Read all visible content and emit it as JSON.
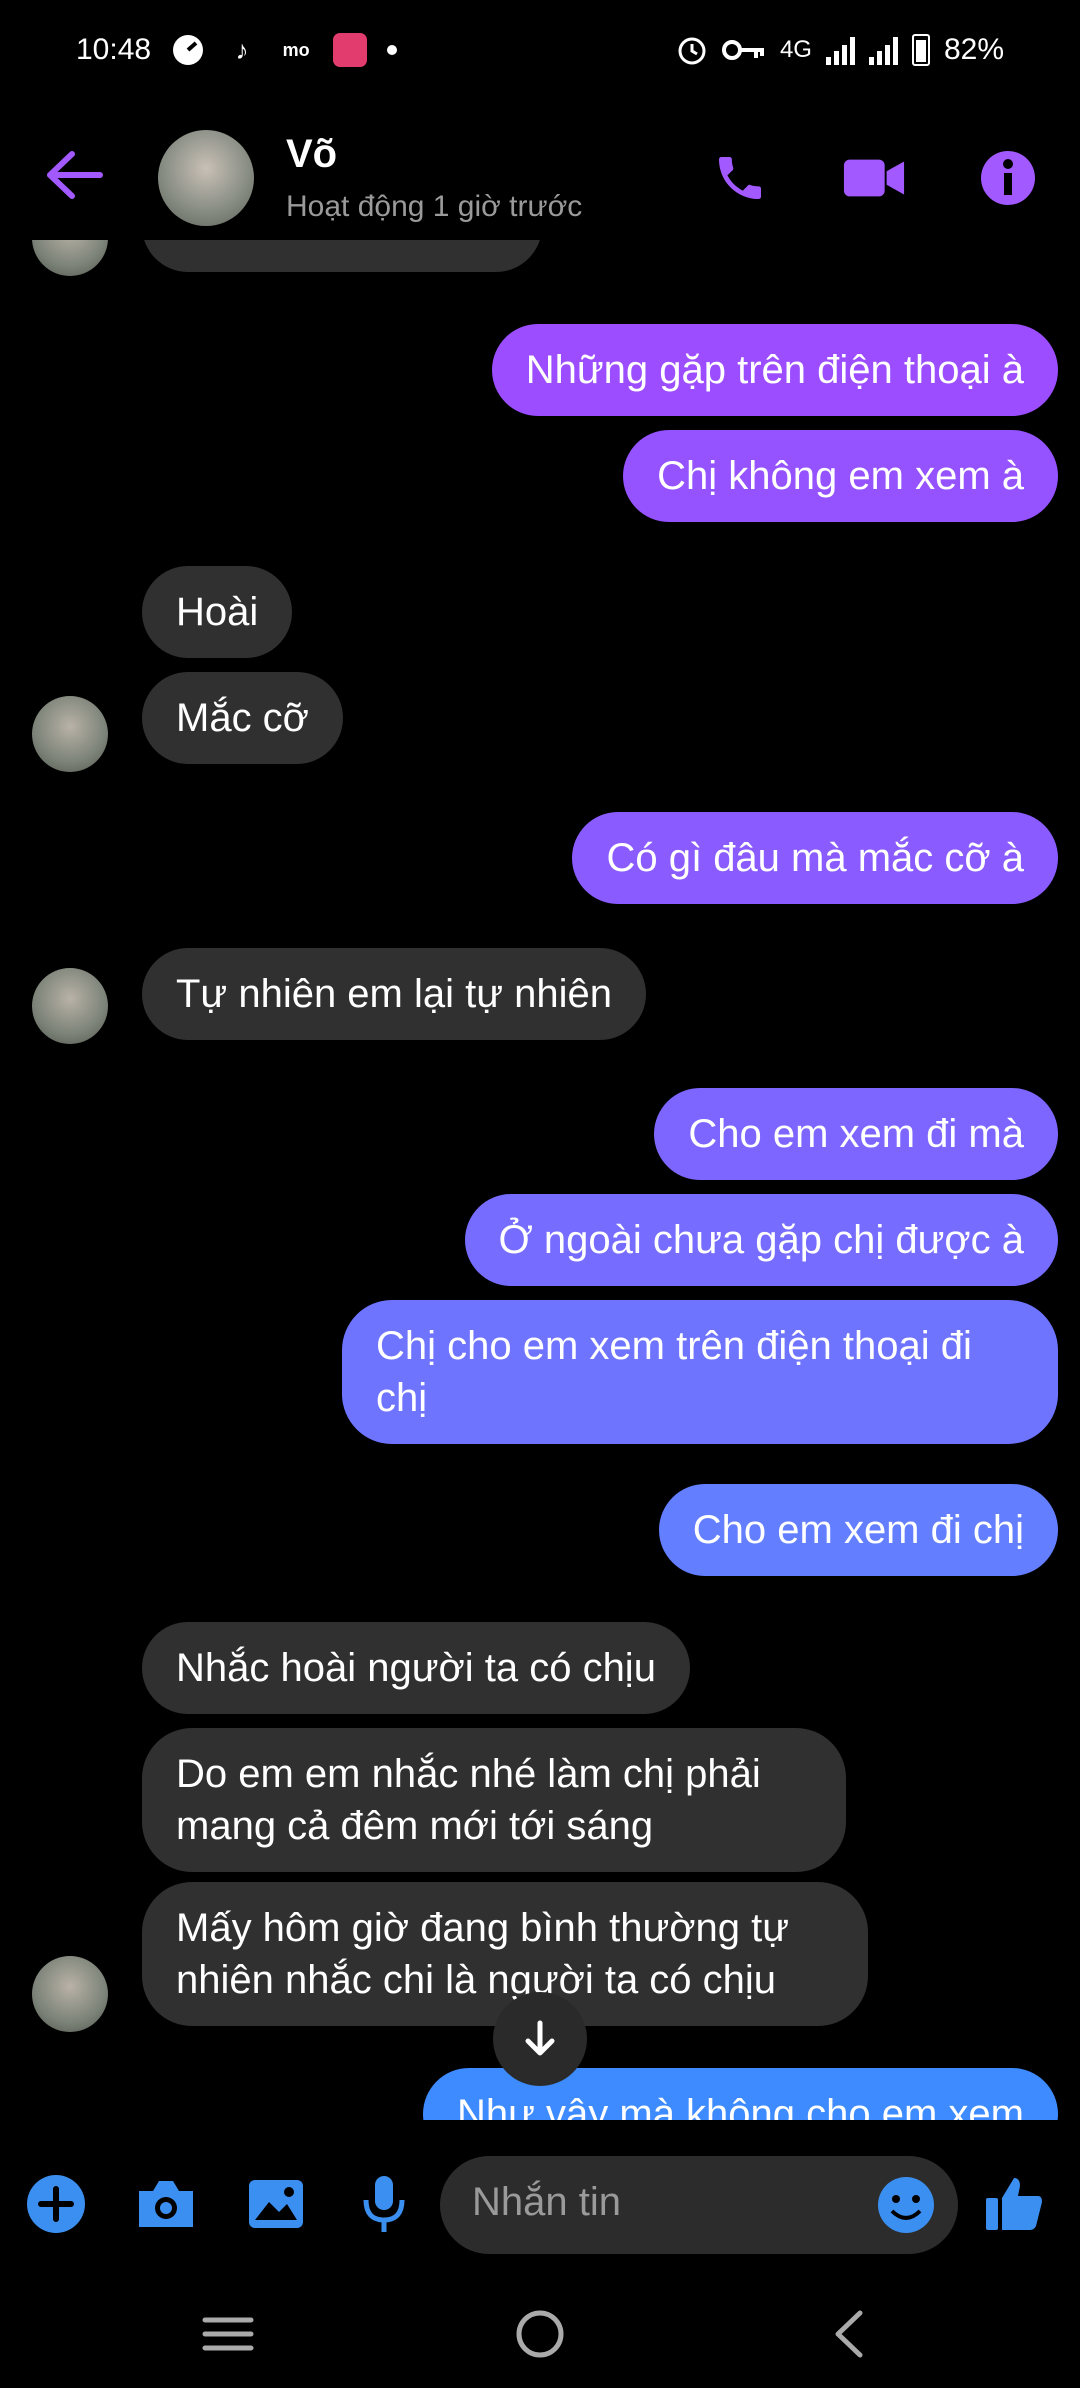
{
  "status_bar": {
    "time": "10:48",
    "network": "4G",
    "battery": "82%"
  },
  "header": {
    "contact_name": "Võ",
    "activity": "Hoạt động 1 giờ trước"
  },
  "messages": [
    {
      "dir": "out",
      "text": "Những gặp trên điện thoại à"
    },
    {
      "dir": "out",
      "text": "Chị không em xem à"
    },
    {
      "dir": "in",
      "text": "Hoài"
    },
    {
      "dir": "in",
      "text": "Mắc cỡ"
    },
    {
      "dir": "out",
      "text": "Có gì đâu mà mắc cỡ à"
    },
    {
      "dir": "in",
      "text": "Tự nhiên em lại tự nhiên"
    },
    {
      "dir": "out",
      "text": "Cho em xem đi mà"
    },
    {
      "dir": "out",
      "text": "Ở ngoài chưa gặp chị được à"
    },
    {
      "dir": "out",
      "text": "Chị cho em xem trên điện thoại đi chị"
    },
    {
      "dir": "out",
      "text": "Cho em xem đi chị"
    },
    {
      "dir": "in",
      "text": "Nhắc hoài người ta có chịu"
    },
    {
      "dir": "in",
      "text": "Do em em nhắc nhé làm chị phải mang cả đêm mới tới sáng"
    },
    {
      "dir": "in",
      "text": "Mấy hôm giờ đang bình thường tự nhiên nhắc chi là người ta có chịu"
    },
    {
      "dir": "out",
      "text": "Như vậy mà không cho em xem"
    }
  ],
  "composer": {
    "placeholder": "Nhắn tin"
  },
  "colors": {
    "accent": "#a259ff",
    "bubble_in": "#303030",
    "gradient_top": "#9b4dff",
    "gradient_bottom": "#3d8bff",
    "composer_icon": "#3b8ff0"
  },
  "icons": [
    "back-arrow-icon",
    "phone-icon",
    "video-icon",
    "info-icon",
    "plus-icon",
    "camera-icon",
    "image-icon",
    "mic-icon",
    "emoji-icon",
    "like-icon",
    "arrow-down-icon",
    "menu-icon",
    "home-icon",
    "back-icon"
  ]
}
